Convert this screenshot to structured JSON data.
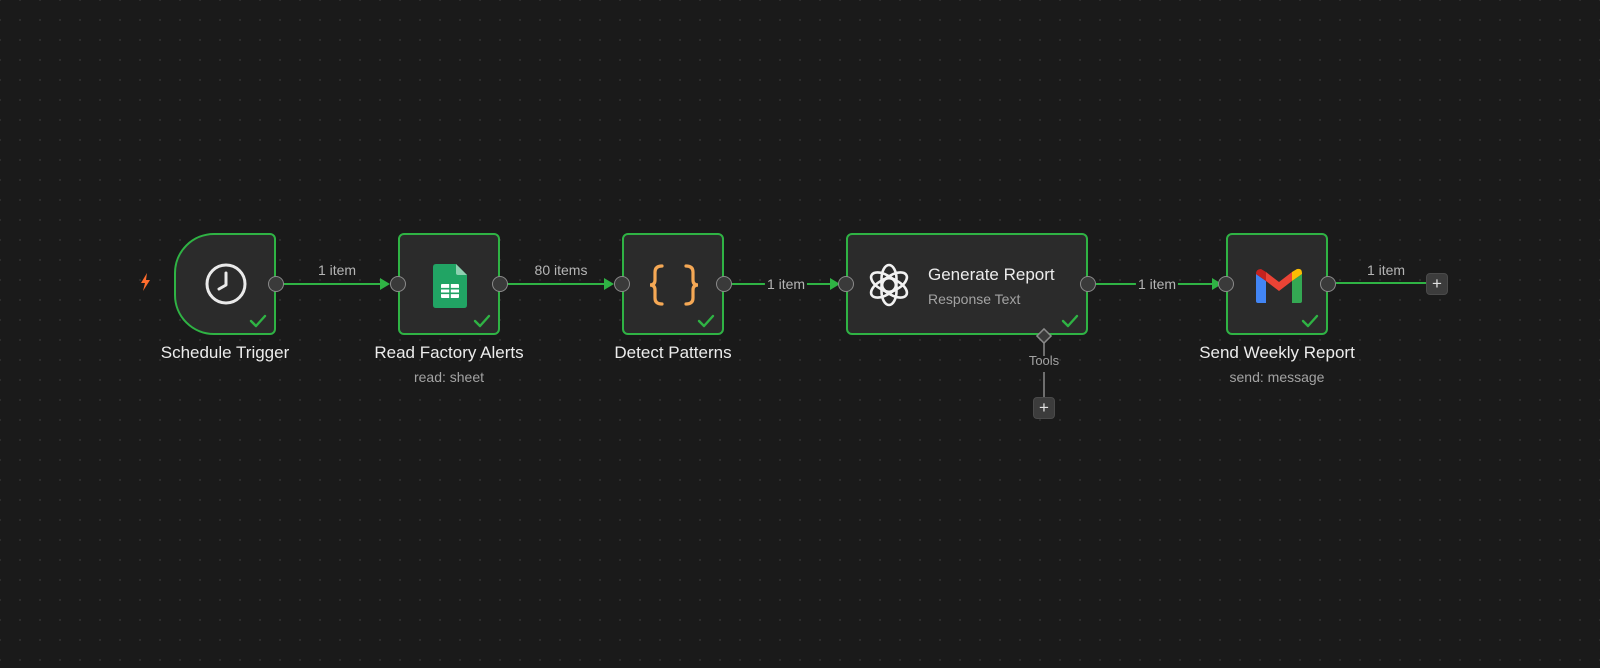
{
  "canvas": {
    "background": "#1a1a1a",
    "dot_color": "#2e2e2e"
  },
  "colors": {
    "success": "#2fb344",
    "trigger_bolt": "#ff6d2e",
    "edge": "#2fb344",
    "code_braces": "#f5a855"
  },
  "nodes": [
    {
      "id": "schedule",
      "label": "Schedule Trigger",
      "icon": "clock-icon",
      "status": "success"
    },
    {
      "id": "sheets",
      "label": "Read Factory Alerts",
      "subtitle": "read: sheet",
      "icon": "google-sheets-icon",
      "status": "success"
    },
    {
      "id": "code",
      "label": "Detect Patterns",
      "icon": "code-braces-icon",
      "status": "success"
    },
    {
      "id": "openai",
      "label": "Generate Report",
      "subtitle": "Response Text",
      "icon": "openai-icon",
      "status": "success",
      "tools_label": "Tools"
    },
    {
      "id": "gmail",
      "label": "Send Weekly Report",
      "subtitle": "send: message",
      "icon": "gmail-icon",
      "status": "success"
    }
  ],
  "edges": [
    {
      "from": "schedule",
      "to": "sheets",
      "label": "1 item"
    },
    {
      "from": "sheets",
      "to": "code",
      "label": "80 items"
    },
    {
      "from": "code",
      "to": "openai",
      "label": "1 item"
    },
    {
      "from": "openai",
      "to": "gmail",
      "label": "1 item"
    },
    {
      "from": "gmail",
      "to": "end",
      "label": "1 item"
    }
  ],
  "buttons": {
    "add": "+"
  }
}
